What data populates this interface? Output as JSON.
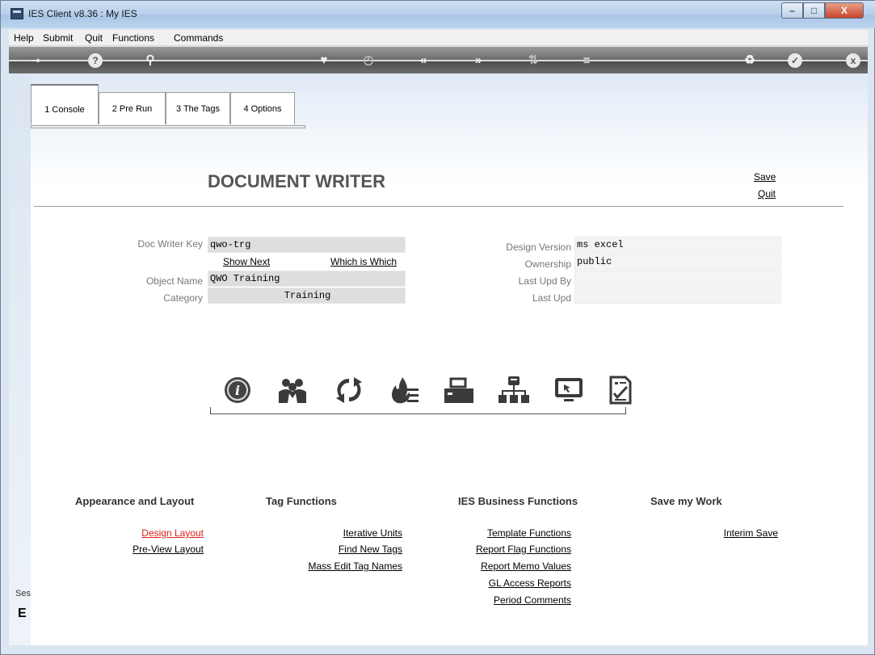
{
  "window": {
    "title": "IES Client v8.36 : My IES",
    "controls": {
      "minimize": "–",
      "maximize": "□",
      "close": "X"
    }
  },
  "menu": [
    "Help",
    "Submit",
    "Quit",
    "Functions",
    "Commands"
  ],
  "toolbar": {
    "icons": [
      "key-icon",
      "help-icon",
      "search-icon",
      "heart-icon",
      "clock-icon",
      "rewind-icon",
      "fast-forward-icon",
      "sort-icon",
      "stop-icon",
      "recycle-icon",
      "check-icon",
      "close-icon"
    ]
  },
  "tabs": [
    {
      "label": "1 Console",
      "active": true
    },
    {
      "label": "2 Pre Run",
      "active": false
    },
    {
      "label": "3 The Tags",
      "active": false
    },
    {
      "label": "4 Options",
      "active": false
    }
  ],
  "header": {
    "title": "DOCUMENT WRITER",
    "save_label": "Save",
    "quit_label": "Quit"
  },
  "form": {
    "doc_writer_key": {
      "label": "Doc Writer Key",
      "value": "qwo-trg"
    },
    "show_next": "Show Next",
    "which_is_which": "Which is Which",
    "object_name": {
      "label": "Object Name",
      "value": "QWO Training"
    },
    "category": {
      "label": "Category",
      "value": "Training"
    },
    "design_version": {
      "label": "Design Version",
      "value": "ms excel"
    },
    "ownership": {
      "label": "Ownership",
      "value": "public"
    },
    "last_upd_by": {
      "label": "Last Upd By",
      "value": ""
    },
    "last_upd": {
      "label": "Last Upd",
      "value": ""
    }
  },
  "function_icons": [
    "info-icon",
    "users-icon",
    "refresh-icon",
    "fire-list-icon",
    "printer-icon",
    "hierarchy-icon",
    "monitor-icon",
    "checklist-document-icon"
  ],
  "sections": {
    "appearance": {
      "title": "Appearance and Layout",
      "links": [
        "Design Layout",
        "Pre-View Layout"
      ]
    },
    "tag_functions": {
      "title": "Tag Functions",
      "links": [
        "Iterative Units",
        "Find New Tags",
        "Mass Edit Tag Names"
      ]
    },
    "business": {
      "title": "IES Business Functions",
      "links": [
        "Template Functions",
        "Report Flag Functions",
        "Report Memo Values",
        "GL Access Reports",
        "Period Comments"
      ]
    },
    "save_work": {
      "title": "Save my Work",
      "links": [
        "Interim Save"
      ]
    }
  },
  "side_panel": {
    "label": "Ses",
    "glyph": "E"
  },
  "colors": {
    "accent_link_red": "#e01e1e",
    "title_gray": "#555555",
    "toolbar_dark": "#4e4e4e"
  }
}
